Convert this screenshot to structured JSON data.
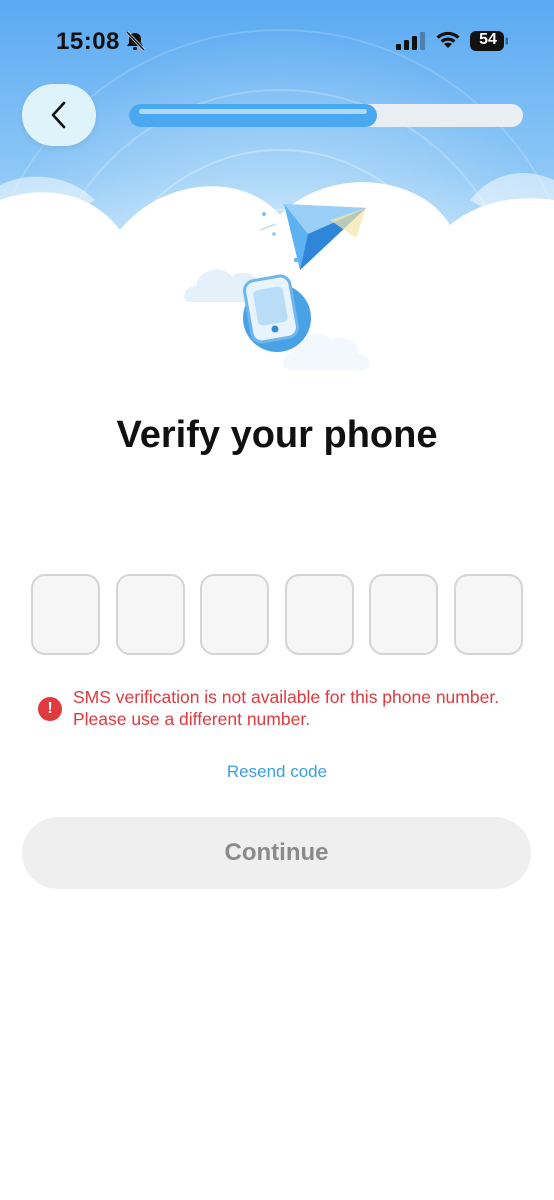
{
  "status_bar": {
    "time": "15:08",
    "battery": "54",
    "bell_icon": "bell-slash-icon",
    "signal_icon": "cellular-signal-icon",
    "wifi_icon": "wifi-icon"
  },
  "header": {
    "back_icon": "chevron-left-icon",
    "progress_fraction": 0.63
  },
  "illustration": {
    "icons": [
      "paper-plane-icon",
      "phone-icon",
      "cloud-icon"
    ]
  },
  "main": {
    "title": "Verify your phone",
    "code_length": 6,
    "error_message_line1": "SMS verification is not available for this phone number.",
    "error_message_line2": "Please use a different number.",
    "error_icon": "!",
    "resend_label": "Resend code",
    "continue_label": "Continue"
  },
  "colors": {
    "accent": "#4aa8f0",
    "error": "#e0393e",
    "link": "#3a9ee6",
    "button_disabled_bg": "#efefef",
    "button_disabled_text": "#8a8a8a"
  }
}
